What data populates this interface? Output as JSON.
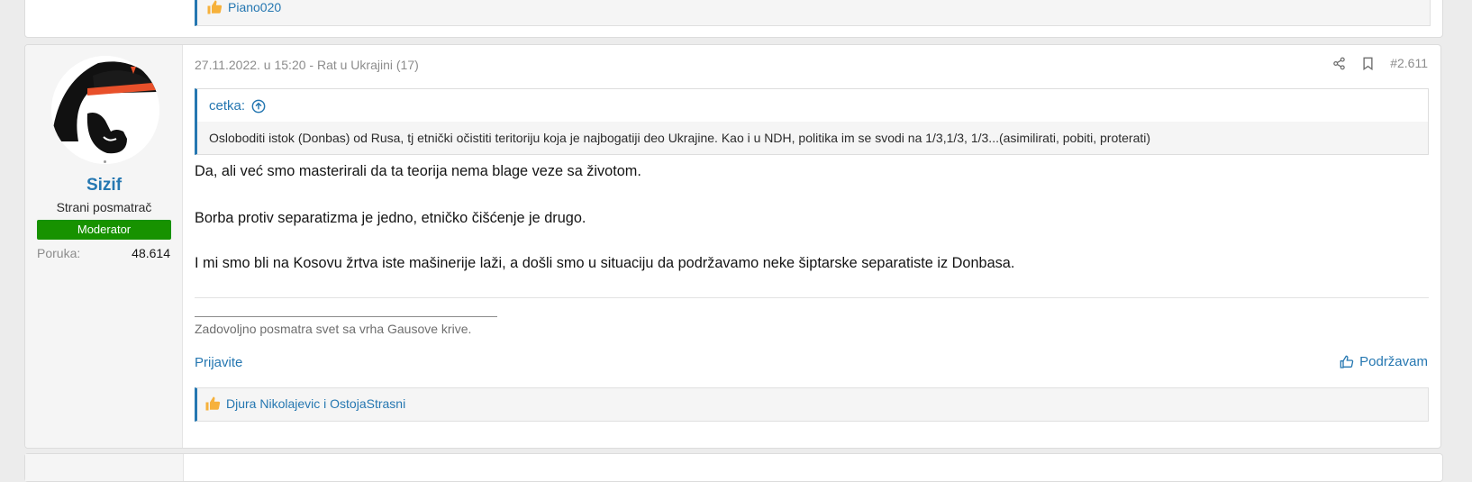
{
  "previous_post": {
    "reactors": "Piano020"
  },
  "post": {
    "user": {
      "username": "Sizif",
      "title": "Strani posmatrač",
      "banner": "Moderator",
      "stat_label": "Poruka:",
      "stat_value": "48.614"
    },
    "header": {
      "date_thread": "27.11.2022. u 15:20 - Rat u Ukrajini (17)",
      "post_number": "#2.611"
    },
    "quote": {
      "author": "cetka:",
      "text": "Osloboditi istok (Donbas) od Rusa, tj etnički očistiti teritoriju koja je najbogatiji deo Ukrajine. Kao i u NDH, politika im se svodi na 1/3,1/3, 1/3...(asimilirati, pobiti, proterati)"
    },
    "message": [
      "Da, ali već smo masterirali da ta teorija nema blage veze sa životom.",
      "Borba protiv separatizma je jedno, etničko čišćenje je drugo.",
      "I mi smo bli na Kosovu žrtva iste mašinerije laži, a došli smo u situaciju da podržavamo neke šiptarske separatiste iz Donbasa."
    ],
    "signature": "Zadovoljno posmatra svet sa vrha Gausove krive.",
    "actions": {
      "report": "Prijavite",
      "like": "Podržavam"
    },
    "reactors": "Djura Nikolajevic i OstojaStrasni"
  },
  "colors": {
    "accent": "#2577b1",
    "banner": "#179200",
    "background": "#ececec",
    "like_icon": "#f6b13b"
  },
  "icons": [
    "thumbs-up-icon",
    "share-icon",
    "bookmark-icon",
    "arrow-up-circle-icon",
    "like-outline-icon"
  ]
}
